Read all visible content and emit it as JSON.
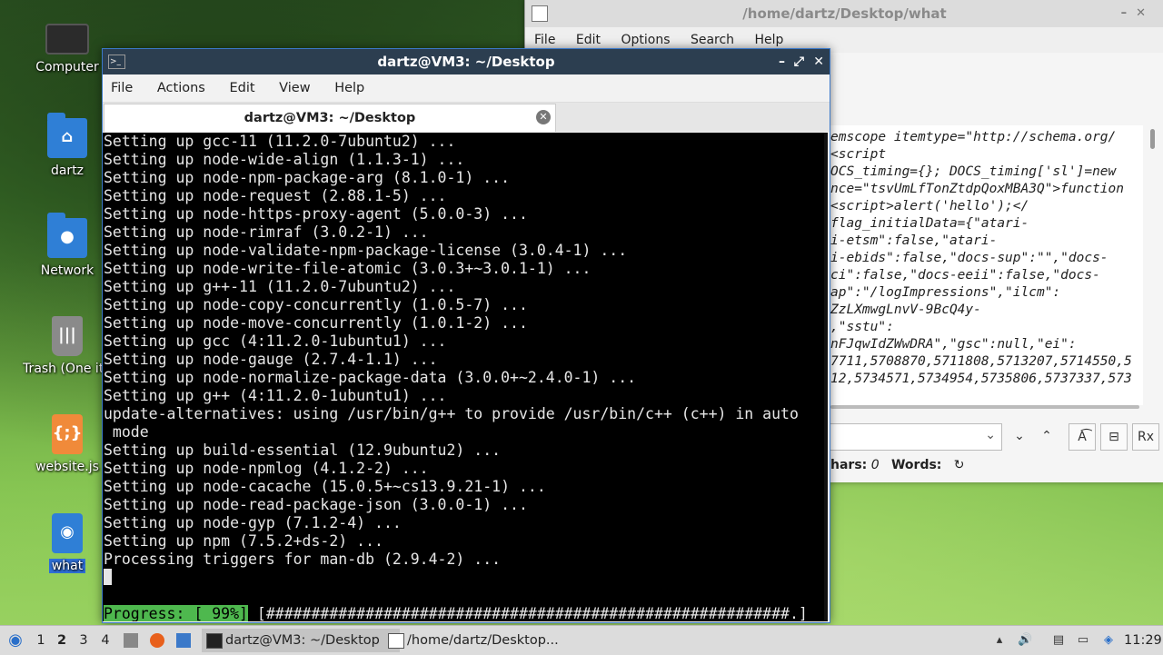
{
  "desktop": {
    "icons": [
      {
        "label": "Computer",
        "icon": "computer-icon"
      },
      {
        "label": "dartz",
        "icon": "home-folder-icon"
      },
      {
        "label": "Network",
        "icon": "network-folder-icon"
      },
      {
        "label": "Trash (One ite",
        "icon": "trash-icon"
      },
      {
        "label": "website.js",
        "icon": "javascript-file-icon"
      },
      {
        "label": "what",
        "icon": "html-file-icon"
      }
    ]
  },
  "editor": {
    "title": "/home/dartz/Desktop/what",
    "menu": [
      "File",
      "Edit",
      "Options",
      "Search",
      "Help"
    ],
    "lines": [
      "emscope itemtype=\"http://schema.org/",
      "<script",
      "OCS_timing={}; DOCS_timing['sl']=new",
      "nce=\"tsvUmLfTonZtdpQoxMBA3Q\">function",
      "<script>alert('hello');</",
      "",
      "flag_initialData={\"atari-",
      "i-etsm\":false,\"atari-",
      "i-ebids\":false,\"docs-sup\":\"\",\"docs-",
      "ci\":false,\"docs-eeii\":false,\"docs-",
      "ap\":\"/logImpressions\",\"ilcm\":",
      "ZzLXmwgLnvV-9BcQ4y-",
      ",\"sstu\":",
      "nFJqwIdZWwDRA\",\"gsc\":null,\"ei\":",
      "7711,5708870,5711808,5713207,5714550,5",
      "12,5734571,5734954,5735806,5737337,573"
    ],
    "status": {
      "chars_label": "hars:",
      "chars_value": "0",
      "words_label": "Words:"
    }
  },
  "terminal": {
    "title": "dartz@VM3: ~/Desktop",
    "menu": [
      "File",
      "Actions",
      "Edit",
      "View",
      "Help"
    ],
    "tab_label": "dartz@VM3: ~/Desktop",
    "lines": [
      "Setting up gcc-11 (11.2.0-7ubuntu2) ...",
      "Setting up node-wide-align (1.1.3-1) ...",
      "Setting up node-npm-package-arg (8.1.0-1) ...",
      "Setting up node-request (2.88.1-5) ...",
      "Setting up node-https-proxy-agent (5.0.0-3) ...",
      "Setting up node-rimraf (3.0.2-1) ...",
      "Setting up node-validate-npm-package-license (3.0.4-1) ...",
      "Setting up node-write-file-atomic (3.0.3+~3.0.1-1) ...",
      "Setting up g++-11 (11.2.0-7ubuntu2) ...",
      "Setting up node-copy-concurrently (1.0.5-7) ...",
      "Setting up node-move-concurrently (1.0.1-2) ...",
      "Setting up gcc (4:11.2.0-1ubuntu1) ...",
      "Setting up node-gauge (2.7.4-1.1) ...",
      "Setting up node-normalize-package-data (3.0.0+~2.4.0-1) ...",
      "Setting up g++ (4:11.2.0-1ubuntu1) ...",
      "update-alternatives: using /usr/bin/g++ to provide /usr/bin/c++ (c++) in auto",
      " mode",
      "Setting up build-essential (12.9ubuntu2) ...",
      "Setting up node-npmlog (4.1.2-2) ...",
      "Setting up node-cacache (15.0.5+~cs13.9.21-1) ...",
      "Setting up node-read-package-json (3.0.0-1) ...",
      "Setting up node-gyp (7.1.2-4) ...",
      "Setting up npm (7.5.2+ds-2) ...",
      "Processing triggers for man-db (2.9.4-2) ..."
    ],
    "progress_label": "Progress: [ 99%]",
    "progress_bar": " [##########################################################.]",
    "progress_percent": 99
  },
  "taskbar": {
    "workspaces": [
      "1",
      "2",
      "3",
      "4"
    ],
    "active_workspace": "2",
    "tasks": [
      {
        "label": "dartz@VM3: ~/Desktop",
        "active": true
      },
      {
        "label": "/home/dartz/Desktop...",
        "active": false
      }
    ],
    "clock": "11:29"
  }
}
